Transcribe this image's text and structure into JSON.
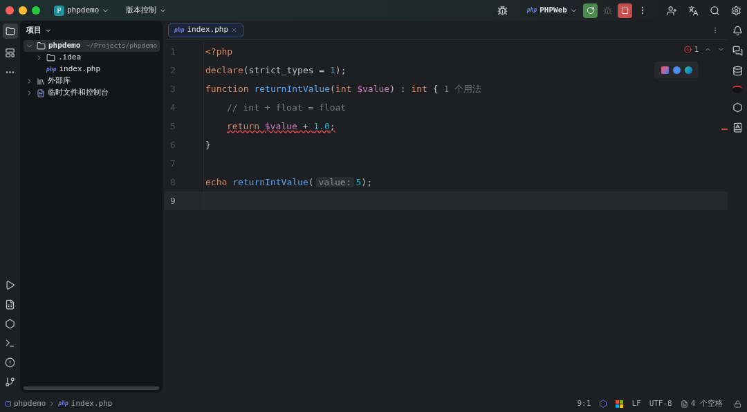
{
  "title_bar": {
    "project": "phpdemo",
    "project_badge": "P",
    "vcs": "版本控制",
    "run_config": "PHPWeb",
    "run_config_icon_text": "php"
  },
  "project_panel": {
    "title": "项目",
    "tree": [
      {
        "name": "phpdemo",
        "path": "~/Projects/phpdemo",
        "kind": "module",
        "expanded": true,
        "selected": true,
        "children": [
          {
            "name": ".idea",
            "kind": "folder",
            "expanded": false,
            "selected": false
          },
          {
            "name": "index.php",
            "kind": "php",
            "icon_text": "php",
            "selected": false
          }
        ]
      },
      {
        "name": "外部库",
        "kind": "library",
        "expanded": false,
        "selected": false
      },
      {
        "name": "临时文件和控制台",
        "kind": "scratch",
        "expanded": false,
        "selected": false
      }
    ]
  },
  "editor": {
    "tabs": [
      {
        "label": "index.php",
        "icon_text": "php",
        "selected": true
      }
    ],
    "error_count": "1",
    "lines": [
      {
        "number": "1",
        "current": false,
        "indented": false,
        "error": false,
        "tokens": [
          {
            "kind": "keyword",
            "text": "<?php"
          }
        ]
      },
      {
        "number": "2",
        "current": false,
        "indented": false,
        "error": false,
        "tokens": [
          {
            "kind": "keyword",
            "text": "declare"
          },
          {
            "kind": "plain",
            "text": "(strict_types = "
          },
          {
            "kind": "number",
            "text": "1"
          },
          {
            "kind": "plain",
            "text": ");"
          }
        ]
      },
      {
        "number": "3",
        "current": false,
        "indented": false,
        "error": false,
        "tokens": [
          {
            "kind": "keyword",
            "text": "function "
          },
          {
            "kind": "function",
            "text": "returnIntValue"
          },
          {
            "kind": "plain",
            "text": "("
          },
          {
            "kind": "keyword",
            "text": "int "
          },
          {
            "kind": "variable",
            "text": "$value"
          },
          {
            "kind": "plain",
            "text": ") : "
          },
          {
            "kind": "keyword",
            "text": "int "
          },
          {
            "kind": "plain",
            "text": "{"
          },
          {
            "kind": "usage",
            "text": "1 个用法"
          }
        ]
      },
      {
        "number": "4",
        "current": false,
        "indented": true,
        "error": false,
        "tokens": [
          {
            "kind": "comment",
            "text": "// int + float = float"
          }
        ]
      },
      {
        "number": "5",
        "current": false,
        "indented": true,
        "error": true,
        "tokens": [
          {
            "kind": "keyword",
            "text": "return "
          },
          {
            "kind": "variable",
            "text": "$value"
          },
          {
            "kind": "plain",
            "text": " + "
          },
          {
            "kind": "number",
            "text": "1.0"
          },
          {
            "kind": "plain",
            "text": ";"
          }
        ]
      },
      {
        "number": "6",
        "current": false,
        "indented": false,
        "error": false,
        "tokens": [
          {
            "kind": "plain",
            "text": "}"
          }
        ]
      },
      {
        "number": "7",
        "current": false
      },
      {
        "number": "8",
        "current": false,
        "indented": false,
        "error": false,
        "tokens": [
          {
            "kind": "keyword",
            "text": "echo "
          },
          {
            "kind": "function",
            "text": "returnIntValue"
          },
          {
            "kind": "plain",
            "text": "("
          },
          {
            "kind": "hint",
            "text": "value:"
          },
          {
            "kind": "number",
            "text": "5"
          },
          {
            "kind": "plain",
            "text": ");"
          }
        ]
      },
      {
        "number": "9",
        "current": true
      }
    ]
  },
  "status_bar": {
    "breadcrumbs": [
      {
        "label": "phpdemo",
        "kind": "module"
      },
      {
        "label": "index.php",
        "kind": "php",
        "icon_text": "php"
      }
    ],
    "position": "9:1",
    "line_separator": "LF",
    "encoding": "UTF-8",
    "indent": "4 个空格"
  }
}
